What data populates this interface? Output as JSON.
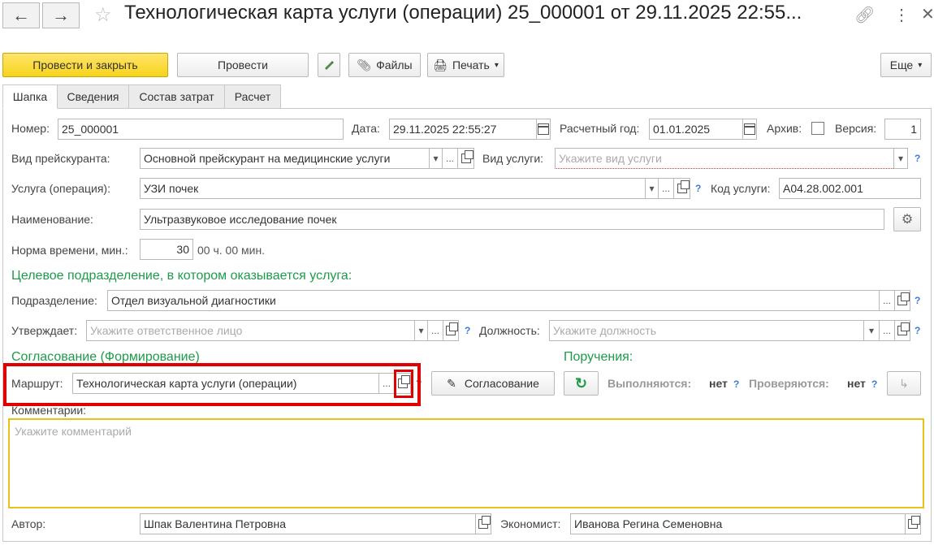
{
  "window": {
    "title": "Технологическая карта услуги (операции) 25_000001 от 29.11.2025 22:55...",
    "back_icon": "arrow-left",
    "forward_icon": "arrow-right",
    "star_icon": "star",
    "link_icon": "link",
    "more_icon": "vertical-dots",
    "close_icon": "close"
  },
  "toolbar": {
    "post_close": "Провести и закрыть",
    "post": "Провести",
    "files": "Файлы",
    "print": "Печать",
    "more": "Еще"
  },
  "tabs": [
    "Шапка",
    "Сведения",
    "Состав затрат",
    "Расчет"
  ],
  "form": {
    "number_label": "Номер:",
    "number": "25_000001",
    "date_label": "Дата:",
    "date": "29.11.2025 22:55:27",
    "year_label": "Расчетный год:",
    "year": "01.01.2025",
    "archive_label": "Архив:",
    "version_label": "Версия:",
    "version": "1",
    "pricelist_label": "Вид прейскуранта:",
    "pricelist": "Основной прейскурант на медицинские услуги",
    "service_kind_label": "Вид услуги:",
    "service_kind_placeholder": "Укажите вид услуги",
    "service_label": "Услуга (операция):",
    "service": "УЗИ почек",
    "service_code_label": "Код услуги:",
    "service_code": "A04.28.002.001",
    "name_label": "Наименование:",
    "name": "Ультразвуковое исследование почек",
    "time_norm_label": "Норма времени, мин.:",
    "time_norm": "30",
    "time_norm_text": "00 ч. 00 мин.",
    "target_section": "Целевое подразделение, в котором оказывается услуга:",
    "department_label": "Подразделение:",
    "department": "Отдел визуальной диагностики",
    "approves_label": "Утверждает:",
    "approves_placeholder": "Укажите ответственное лицо",
    "position_label": "Должность:",
    "position_placeholder": "Укажите должность",
    "approval_section": "Согласование (Формирование)",
    "route_label": "Маршрут:",
    "route": "Технологическая карта услуги (операции)",
    "approval_button": "Согласование",
    "tasks_section": "Поручения:",
    "executing_label": "Выполняются:",
    "executing_value": "нет",
    "checking_label": "Проверяются:",
    "checking_value": "нет",
    "comments_label": "Комментарии:",
    "comments_placeholder": "Укажите комментарий",
    "author_label": "Автор:",
    "author": "Шпак Валентина Петровна",
    "economist_label": "Экономист:",
    "economist": "Иванова Регина Семеновна",
    "question": "?",
    "ellipsis": "...",
    "dropdown_glyph": "▾"
  },
  "colors": {
    "accent_yellow": "#f7d41c",
    "section_green": "#1e9b4a",
    "highlight_red": "#e00000",
    "comment_border": "#e6c21a",
    "help_blue": "#3b7bd4"
  }
}
